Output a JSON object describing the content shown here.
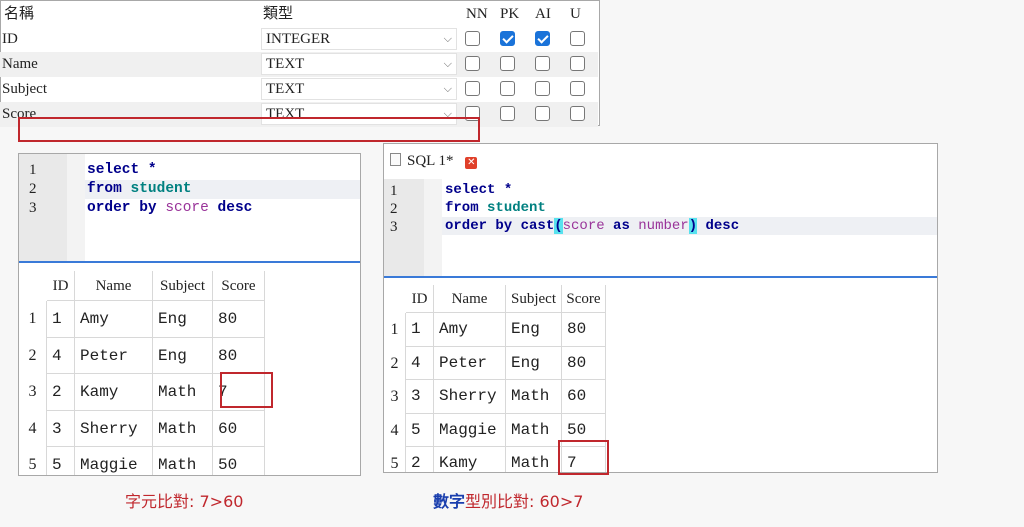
{
  "schema": {
    "headers": {
      "name": "名稱",
      "type": "類型",
      "nn": "NN",
      "pk": "PK",
      "ai": "AI",
      "u": "U"
    },
    "rows": [
      {
        "name": "ID",
        "type": "INTEGER",
        "nn": false,
        "pk": true,
        "ai": true,
        "u": false
      },
      {
        "name": "Name",
        "type": "TEXT",
        "nn": false,
        "pk": false,
        "ai": false,
        "u": false
      },
      {
        "name": "Subject",
        "type": "TEXT",
        "nn": false,
        "pk": false,
        "ai": false,
        "u": false
      },
      {
        "name": "Score",
        "type": "TEXT",
        "nn": false,
        "pk": false,
        "ai": false,
        "u": false
      }
    ]
  },
  "left_editor": {
    "line_numbers": [
      "1",
      "2",
      "3"
    ],
    "sql": {
      "l1": {
        "kw": "select",
        "rest": " *"
      },
      "l2": {
        "kw": "from",
        "table": "student"
      },
      "l3": {
        "kw": "order by",
        "col": "score",
        "kw2": "desc"
      }
    },
    "result": {
      "columns": [
        "ID",
        "Name",
        "Subject",
        "Score"
      ],
      "rows": [
        [
          "1",
          "Amy",
          "Eng",
          "80"
        ],
        [
          "4",
          "Peter",
          "Eng",
          "80"
        ],
        [
          "2",
          "Kamy",
          "Math",
          "7"
        ],
        [
          "3",
          "Sherry",
          "Math",
          "60"
        ],
        [
          "5",
          "Maggie",
          "Math",
          "50"
        ]
      ],
      "row_numbers": [
        "1",
        "2",
        "3",
        "4",
        "5"
      ]
    }
  },
  "right_editor": {
    "tab_label": "SQL 1*",
    "line_numbers": [
      "1",
      "2",
      "3"
    ],
    "sql": {
      "l1": {
        "kw": "select",
        "rest": " *"
      },
      "l2": {
        "kw": "from",
        "table": "student"
      },
      "l3": {
        "kw": "order by cast",
        "open": "(",
        "col": "score",
        "as": "as",
        "type": "number",
        "close": ")",
        "kw2": "desc"
      }
    },
    "result": {
      "columns": [
        "ID",
        "Name",
        "Subject",
        "Score"
      ],
      "rows": [
        [
          "1",
          "Amy",
          "Eng",
          "80"
        ],
        [
          "4",
          "Peter",
          "Eng",
          "80"
        ],
        [
          "3",
          "Sherry",
          "Math",
          "60"
        ],
        [
          "5",
          "Maggie",
          "Math",
          "50"
        ],
        [
          "2",
          "Kamy",
          "Math",
          "7"
        ]
      ],
      "row_numbers": [
        "1",
        "2",
        "3",
        "4",
        "5"
      ]
    }
  },
  "captions": {
    "left": "字元比對: 7>60",
    "right_blue": "數字",
    "right_red": "型別比對: 60>7"
  },
  "colors": {
    "accent_red": "#c0272d",
    "accent_blue": "#1a3fae",
    "checkbox_blue": "#1a73d9"
  }
}
